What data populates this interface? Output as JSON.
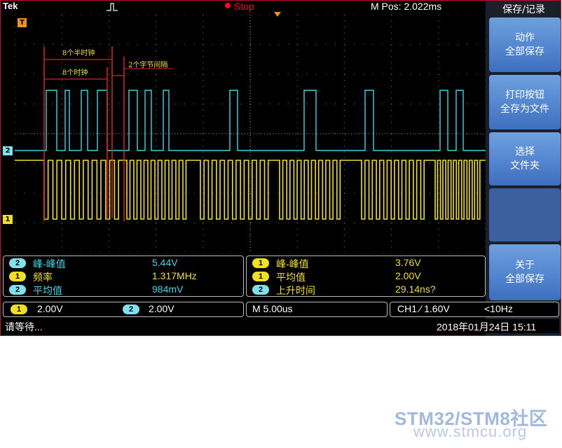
{
  "topbar": {
    "brand": "Tek",
    "state": "Stop",
    "mpos": "M Pos: 2.022ms"
  },
  "annotations": {
    "half_clock": "8个半时钟",
    "clock": "8个时钟",
    "gap": "2个字节间隔"
  },
  "channel_markers": {
    "trigger": "T",
    "ch2": "2",
    "ch1": "1"
  },
  "side_menu": {
    "title": "保存/记录",
    "buttons": [
      "动作\n全部保存",
      "打印按钮\n全存为文件",
      "选择\n文件夹",
      "",
      "关于\n全部保存"
    ]
  },
  "measurements_left": [
    {
      "ch": "2",
      "label": "峰-峰值",
      "value": "5.44V"
    },
    {
      "ch": "1",
      "label": "频率",
      "value": "1.317MHz"
    },
    {
      "ch": "2",
      "label": "平均值",
      "value": "984mV"
    }
  ],
  "measurements_right": [
    {
      "ch": "1",
      "label": "峰-峰值",
      "value": "3.76V"
    },
    {
      "ch": "1",
      "label": "平均值",
      "value": "2.00V"
    },
    {
      "ch": "2",
      "label": "上升时间",
      "value": "29.14ns?"
    }
  ],
  "status": {
    "ch1_scale": "2.00V",
    "ch2_scale": "2.00V",
    "ch1_badge": "1",
    "ch2_badge": "2",
    "timebase": "M 5.00us",
    "trigger": "CH1 ⁄ 1.60V",
    "trigger_freq": "<10Hz",
    "message": "请等待...",
    "datetime": "2018年01月24日 15:11"
  },
  "watermark": {
    "line1": "STM32/STM8社区",
    "line2": "www.stmcu.org"
  },
  "colors": {
    "ch1": "#f0e020",
    "ch2": "#39d7e8",
    "accent": "#e02020"
  }
}
